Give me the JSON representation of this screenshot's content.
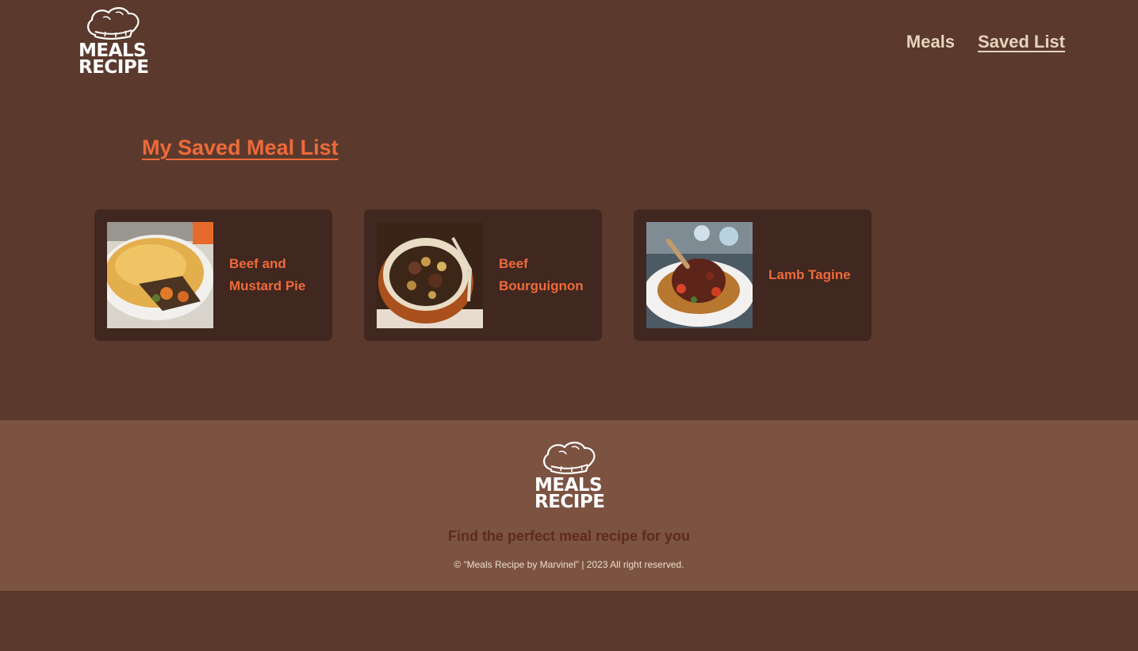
{
  "header": {
    "logo": {
      "line1": "MEALS",
      "line2": "RECIPE",
      "icon": "chef-hat-icon"
    },
    "nav": [
      {
        "label": "Meals",
        "active": false
      },
      {
        "label": "Saved List",
        "active": true
      }
    ]
  },
  "main": {
    "title": "My Saved Meal List",
    "cards": [
      {
        "name": "Beef and Mustard Pie",
        "image": "beef-pie-image"
      },
      {
        "name": "Beef Bourguignon",
        "image": "beef-bourguignon-image"
      },
      {
        "name": "Lamb Tagine",
        "image": "lamb-tagine-image"
      }
    ]
  },
  "footer": {
    "logo": {
      "line1": "MEALS",
      "line2": "RECIPE",
      "icon": "chef-hat-icon"
    },
    "tagline": "Find the perfect meal recipe for you",
    "copyright": "© “Meals Recipe by Marvinel” | 2023 All right reserved."
  },
  "colors": {
    "background": "#5b3a2d",
    "card": "#40271f",
    "accent": "#ee6a3b",
    "nav_text": "#e6d3bd",
    "footer_bg": "#7c5241",
    "tagline": "#5e2b1e"
  }
}
